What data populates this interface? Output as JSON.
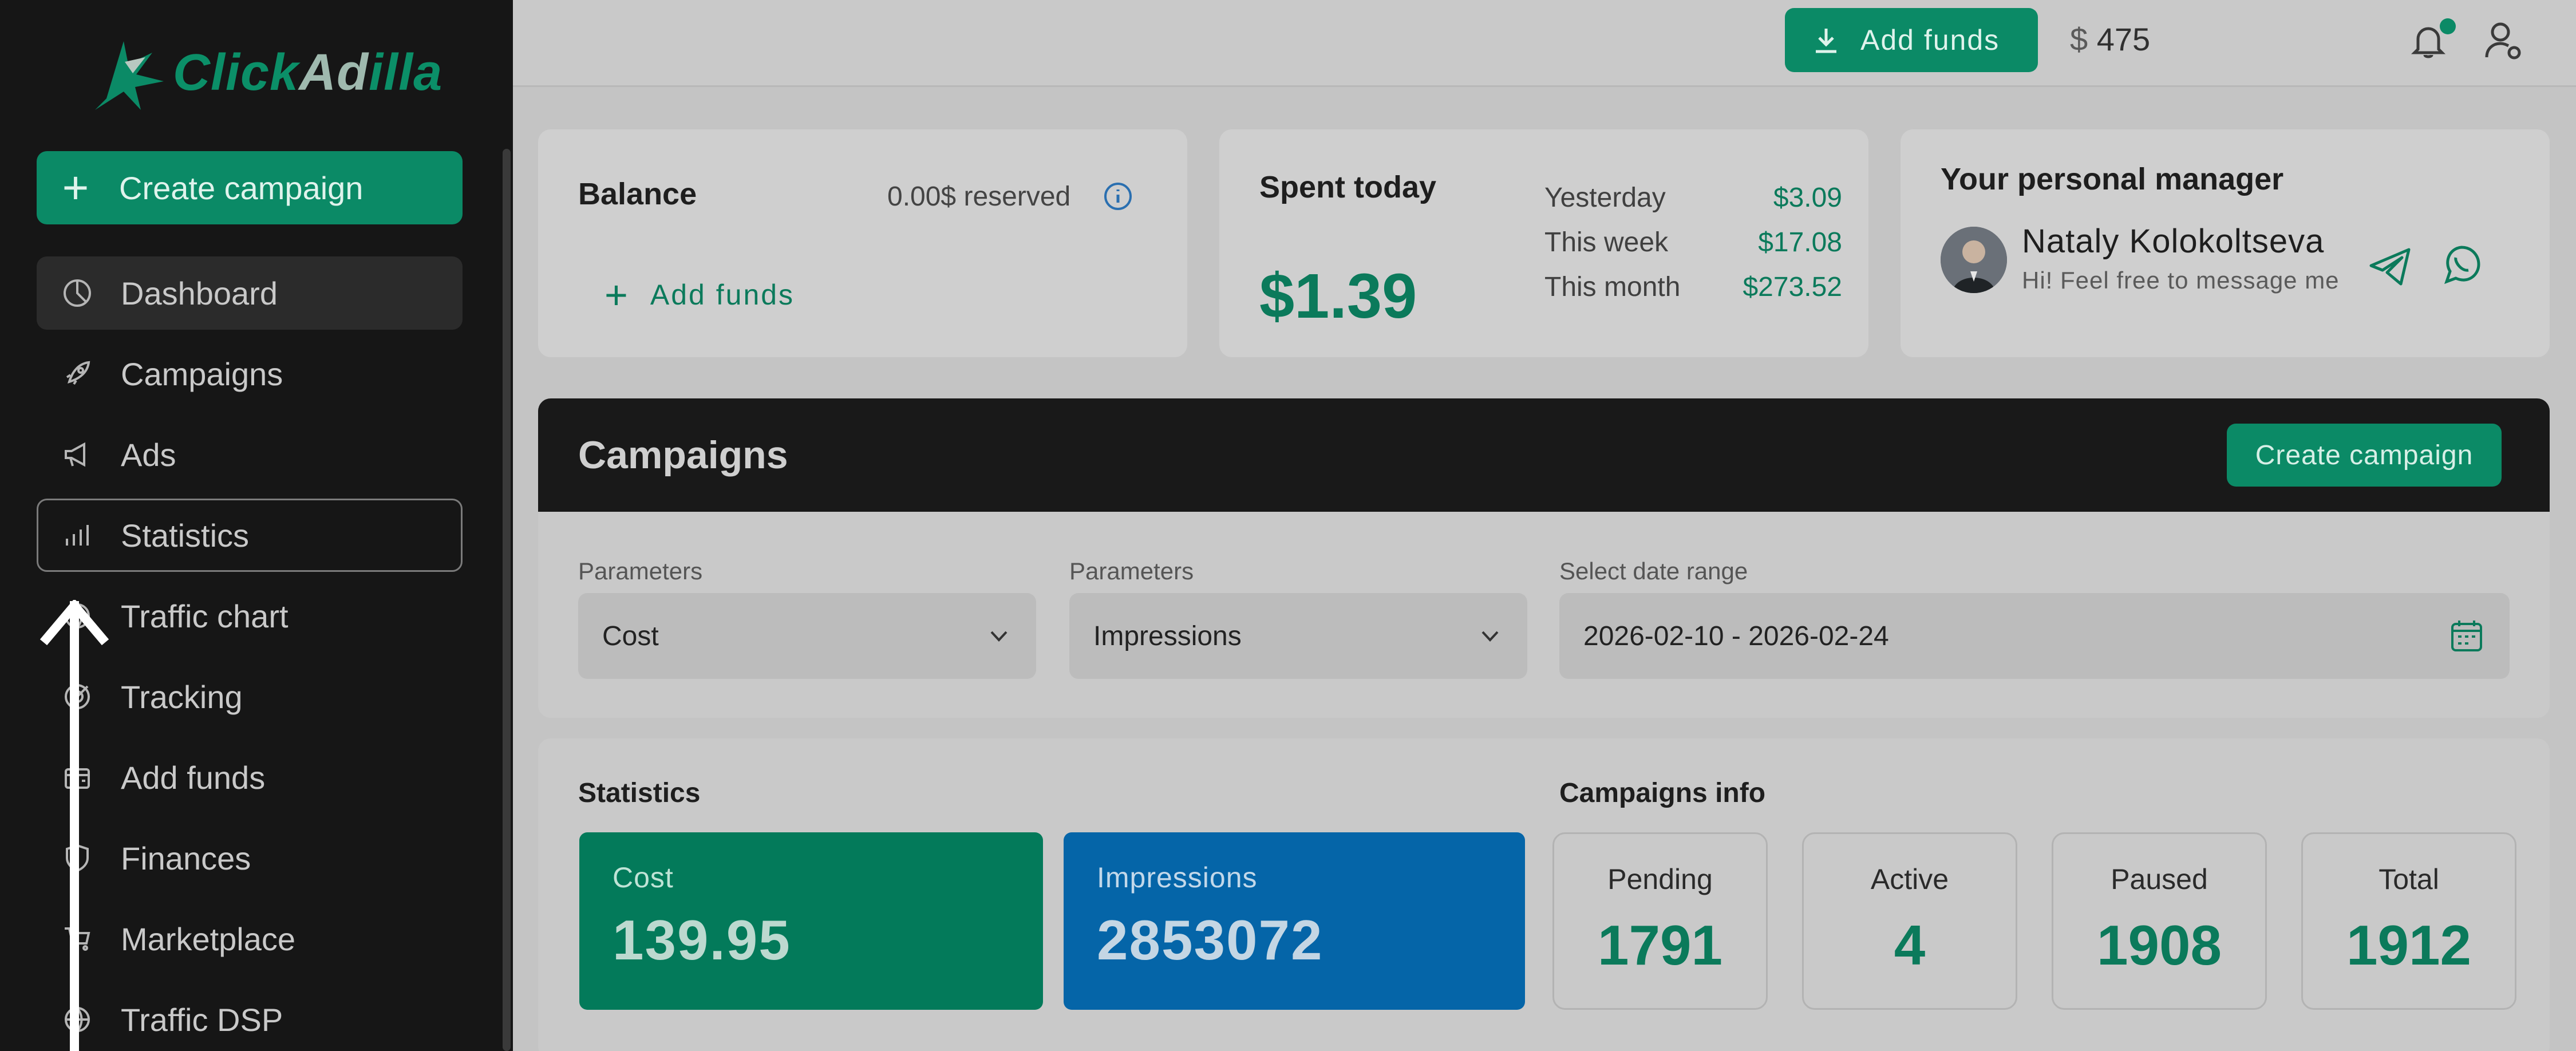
{
  "brand": {
    "name_part1": "Click",
    "name_part2": "Ad",
    "name_part3": "illa"
  },
  "sidebar": {
    "create_label": "Create campaign",
    "items": [
      {
        "label": "Dashboard",
        "icon": "pie-chart-icon"
      },
      {
        "label": "Campaigns",
        "icon": "rocket-icon"
      },
      {
        "label": "Ads",
        "icon": "megaphone-icon"
      },
      {
        "label": "Statistics",
        "icon": "bar-chart-icon"
      },
      {
        "label": "Traffic chart",
        "icon": "globe-icon"
      },
      {
        "label": "Tracking",
        "icon": "target-icon"
      },
      {
        "label": "Add funds",
        "icon": "wallet-icon"
      },
      {
        "label": "Finances",
        "icon": "shield-icon"
      },
      {
        "label": "Marketplace",
        "icon": "cart-icon"
      },
      {
        "label": "Traffic DSP",
        "icon": "globe-icon"
      }
    ]
  },
  "topbar": {
    "add_funds": "Add funds",
    "currency": "$",
    "balance": "475"
  },
  "balance_card": {
    "title": "Balance",
    "reserved": "0.00$ reserved",
    "add_funds": "Add funds"
  },
  "spent_card": {
    "title": "Spent today",
    "value": "$1.39",
    "rows": [
      {
        "label": "Yesterday",
        "value": "$3.09"
      },
      {
        "label": "This week",
        "value": "$17.08"
      },
      {
        "label": "This month",
        "value": "$273.52"
      }
    ]
  },
  "manager_card": {
    "title": "Your personal manager",
    "name": "Nataly Kolokoltseva",
    "message": "Hi! Feel free to message me"
  },
  "campaigns": {
    "title": "Campaigns",
    "create_label": "Create campaign",
    "filters": [
      {
        "label": "Parameters",
        "value": "Cost"
      },
      {
        "label": "Parameters",
        "value": "Impressions"
      },
      {
        "label": "Select date range",
        "value": "2026-02-10 - 2026-02-24"
      }
    ]
  },
  "statistics": {
    "title": "Statistics",
    "cards": [
      {
        "label": "Cost",
        "value": "139.95",
        "color": "#037a5a"
      },
      {
        "label": "Impressions",
        "value": "2853072",
        "color": "#0565a8"
      }
    ]
  },
  "campaigns_info": {
    "title": "Campaigns info",
    "cards": [
      {
        "label": "Pending",
        "value": "1791"
      },
      {
        "label": "Active",
        "value": "4"
      },
      {
        "label": "Paused",
        "value": "1908"
      },
      {
        "label": "Total",
        "value": "1912"
      }
    ]
  },
  "colors": {
    "accent": "#0b8a66",
    "sidebar": "#161616",
    "overlay": "#c4c4c4"
  }
}
